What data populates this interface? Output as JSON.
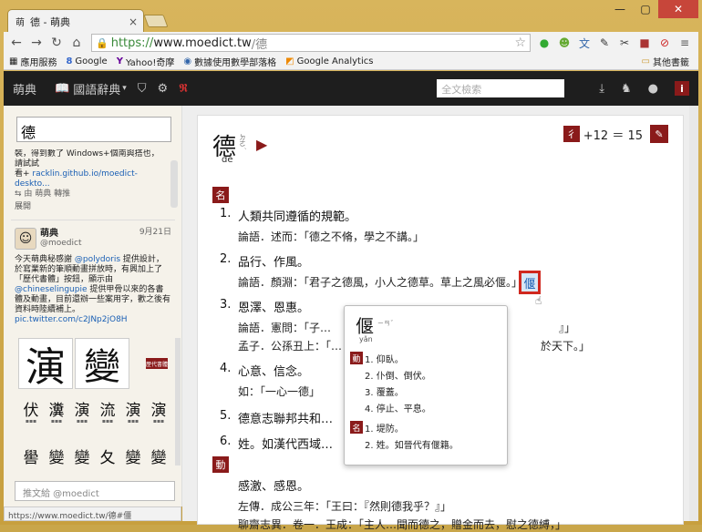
{
  "browser": {
    "tab_title": "德 - 萌典",
    "tab_favicon": "萌",
    "tab_close": "×",
    "url_https": "https://",
    "url_host": "www.moedict.tw",
    "url_path": "/德",
    "status_url": "https://www.moedict.tw/德#僵"
  },
  "bookmarks": [
    {
      "icon": "▦",
      "label": "應用服務"
    },
    {
      "icon": "8",
      "label": "Google"
    },
    {
      "icon": "Y",
      "label": "Yahoo!奇摩"
    },
    {
      "icon": "◉",
      "label": "數據使用數學部落格"
    },
    {
      "icon": "◩",
      "label": "Google Analytics"
    }
  ],
  "bookmarks_other": "其他書籤",
  "appbar": {
    "logo": "萌典",
    "dict_label": "國語辭典",
    "search_placeholder": "全文檢索"
  },
  "sidebar": {
    "search_value": "德",
    "results_line1": "裝，得到數了 Windows+個南與搭也，",
    "results_line2": "請試試",
    "results_line3_prefix": "看+ ",
    "results_link": "racklin.github.io/moedict-deskto...",
    "results_rt": "⇆ 由 萌典 轉推",
    "results_more": "展開",
    "tweet": {
      "avatar": "☺",
      "name": "萌典",
      "handle": "@moedict",
      "date": "9月21日",
      "text1": "今天萌典秘感謝 ",
      "mention1": "@polydoris",
      "text2": " 提供設計，於寫業新的筆順動畫拼放時，有興加上了「歷代書體」按鈕，顯示由 ",
      "mention2": "@chineselingupie",
      "text3": " 提供甲骨以來的各書體及動畫，目前還辦一些案用字，歡之後有資料時陸續補上。",
      "link": "pic.twitter.com/c2JNp2jO8H"
    },
    "glyph1": "演",
    "glyph2": "變",
    "badge": "歷代書體",
    "row1": [
      "伏",
      "瀵",
      "演",
      "流",
      "演",
      "演"
    ],
    "row2": [
      "嚳",
      "變",
      "變",
      "夂",
      "變",
      "變"
    ],
    "tweet_placeholder": "推文給 @moedict"
  },
  "entry": {
    "char": "德",
    "bopomofo": "ㄉㄜˊ",
    "pinyin": "dé",
    "radical": "彳",
    "stroke_text": "+12 ＝ 15",
    "pos1": "名",
    "pos2": "動",
    "defs": [
      {
        "num": "1.",
        "text": "人類共同遵循的規範。",
        "ex": [
          "論語．述而：「德之不脩，學之不講。」"
        ]
      },
      {
        "num": "2.",
        "text": "品行、作風。",
        "ex": [
          "論語．顏淵：「君子之德風，小人之德草。草上之風必偃。」"
        ]
      },
      {
        "num": "3.",
        "text": "恩澤、恩惠。",
        "ex": [
          "論語．憲問：「子…",
          "孟子．公孫丑上：「…"
        ]
      },
      {
        "num": "4.",
        "text": "心意、信念。",
        "ex": [
          "如：「一心一德」"
        ]
      },
      {
        "num": "5.",
        "text": "德意志聯邦共和…",
        "ex": []
      },
      {
        "num": "6.",
        "text": "姓。如漢代西域…",
        "ex": []
      }
    ],
    "ex3_right1": "』」",
    "ex3_right2": "於天下。」",
    "highlight": "偃",
    "verb_def": "感激、感恩。",
    "verb_ex1": "左傳．成公三年：「王曰：『然則德我乎？』」",
    "verb_ex2": "聊齋志異．卷一．王成：「主人…聞而德之，贈金而去，慰之德縛，」"
  },
  "popup": {
    "char": "偃",
    "bopomofo": "ㄧㄢˇ",
    "pinyin": "yǎn",
    "pos1": "動",
    "pos2": "名",
    "verb_defs": [
      "1. 仰臥。",
      "2. 仆倒、倒伏。",
      "3. 覆蓋。",
      "4. 停止、平息。"
    ],
    "noun_defs": [
      "1. 堤防。",
      "2. 姓。如晉代有偃籍。"
    ]
  }
}
